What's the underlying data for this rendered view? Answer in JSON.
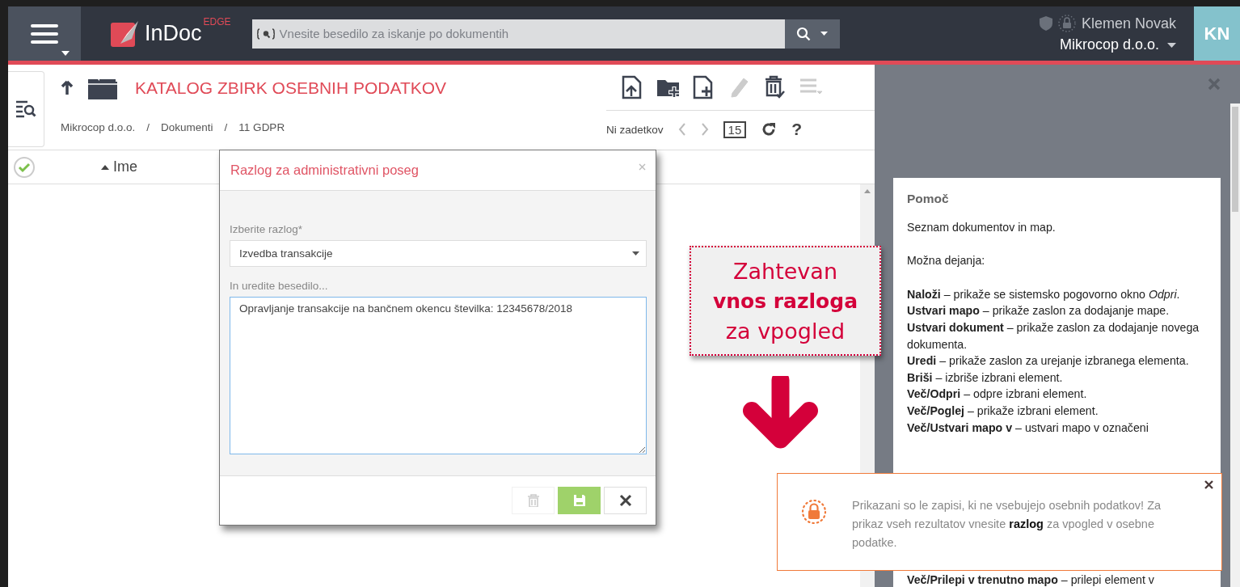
{
  "header": {
    "logo_text": "InDoc",
    "logo_badge": "EDGE",
    "search": {
      "placeholder": "Vnesite besedilo za iskanje po dokumentih"
    },
    "user_name": "Klemen Novak",
    "company": "Mikrocop d.o.o.",
    "avatar": "KN"
  },
  "folder": {
    "title": "KATALOG ZBIRK OSEBNIH PODATKOV",
    "separator": "/",
    "breadcrumbs": [
      "Mikrocop d.o.o.",
      "Dokumenti",
      "11 GDPR"
    ]
  },
  "toolbar": [
    {
      "kind": "upload",
      "disabled": false
    },
    {
      "kind": "new-folder",
      "disabled": false
    },
    {
      "kind": "new-document",
      "disabled": false
    },
    {
      "kind": "edit",
      "disabled": true
    },
    {
      "kind": "delete",
      "disabled": false
    },
    {
      "kind": "more",
      "disabled": true
    }
  ],
  "pager": {
    "status": "Ni zadetkov",
    "page_size": "15",
    "help": "?"
  },
  "table": {
    "columns": [
      {
        "label": "Ime",
        "sorted": true
      }
    ]
  },
  "dialog": {
    "title": "Razlog za administrativni poseg",
    "reason_label": "Izberite razlog*",
    "reason_value": "Izvedba transakcije",
    "text_label": "In uredite besedilo...",
    "text_value": "Opravljanje transakcije na bančnem okencu številka: 12345678/2018",
    "buttons": [
      {
        "kind": "delete",
        "disabled": true
      },
      {
        "kind": "save",
        "disabled": false
      },
      {
        "kind": "cancel",
        "disabled": false
      }
    ]
  },
  "callout": {
    "lines": [
      {
        "text": "Zahtevan",
        "bold": false
      },
      {
        "text": "vnos razloga",
        "bold": true
      },
      {
        "text": "za vpogled",
        "bold": false
      }
    ]
  },
  "help": {
    "title": "Pomoč",
    "intro": "Seznam dokumentov in map.",
    "actions_heading": "Možna dejanja:",
    "items": [
      "**Naloži** – prikaže se sistemsko pogovorno okno *Odpri*.",
      "**Ustvari mapo** – prikaže zaslon za dodajanje mape.",
      "**Ustvari dokument** – prikaže zaslon za dodajanje novega dokumenta.",
      "**Uredi** – prikaže zaslon za urejanje izbranega elementa.",
      "**Briši** – izbriše izbrani element.",
      "**Več/Odpri** – odpre izbrani element.",
      "**Več/Poglej** – prikaže izbrani element.",
      "**Več/Ustvari mapo v** – ustvari mapo v označeni"
    ],
    "cut_items": [
      "**Več/Prilepi v trenutno mapo** – prilepi element v"
    ]
  },
  "toast": {
    "text": "Prikazani so le zapisi, ki ne vsebujejo osebnih podatkov! Za prikaz vseh rezultatov vnesite **razlog** za vpogled v osebne podatke."
  }
}
